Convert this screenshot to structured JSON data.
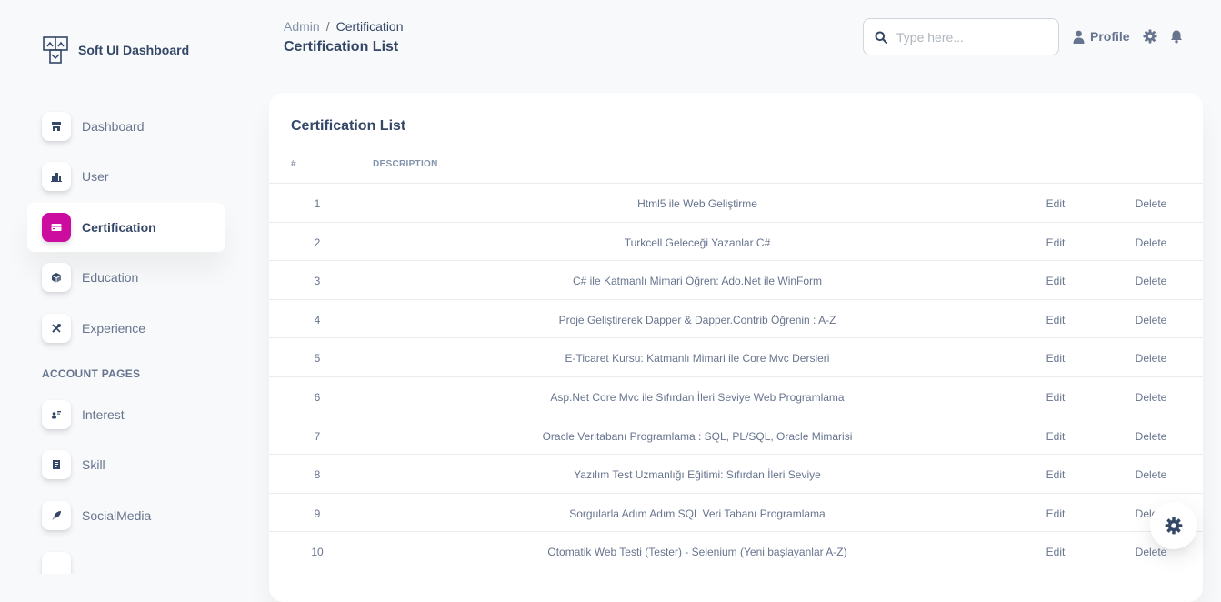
{
  "brand": {
    "name": "Soft UI Dashboard"
  },
  "sidebar": {
    "items": [
      {
        "label": "Dashboard",
        "icon": "shop-icon"
      },
      {
        "label": "User",
        "icon": "office-icon"
      },
      {
        "label": "Certification",
        "icon": "credit-card-icon",
        "active": true
      },
      {
        "label": "Education",
        "icon": "box-icon"
      },
      {
        "label": "Experience",
        "icon": "tools-icon"
      }
    ],
    "section_title": "ACCOUNT PAGES",
    "account_items": [
      {
        "label": "Interest",
        "icon": "user-card-icon"
      },
      {
        "label": "Skill",
        "icon": "document-icon"
      },
      {
        "label": "SocialMedia",
        "icon": "rocket-icon"
      }
    ],
    "accent_color": "#cb0c9f"
  },
  "header": {
    "breadcrumb": {
      "parent": "Admin",
      "separator": "/",
      "current": "Certification"
    },
    "title": "Certification List",
    "search": {
      "placeholder": "Type here...",
      "value": ""
    },
    "profile_label": "Profile"
  },
  "card": {
    "title": "Certification List",
    "columns": [
      "#",
      "DESCRIPTION"
    ],
    "edit_label": "Edit",
    "delete_label": "Delete",
    "rows": [
      {
        "num": "1",
        "description": "Html5 ile Web Geliştirme"
      },
      {
        "num": "2",
        "description": "Turkcell Geleceği Yazanlar C#"
      },
      {
        "num": "3",
        "description": "C# ile Katmanlı Mimari Öğren: Ado.Net ile WinForm"
      },
      {
        "num": "4",
        "description": "Proje Geliştirerek Dapper & Dapper.Contrib Öğrenin : A-Z"
      },
      {
        "num": "5",
        "description": "E-Ticaret Kursu: Katmanlı Mimari ile Core Mvc Dersleri"
      },
      {
        "num": "6",
        "description": "Asp.Net Core Mvc ile Sıfırdan İleri Seviye Web Programlama"
      },
      {
        "num": "7",
        "description": "Oracle Veritabanı Programlama : SQL, PL/SQL, Oracle Mimarisi"
      },
      {
        "num": "8",
        "description": "Yazılım Test Uzmanlığı Eğitimi: Sıfırdan İleri Seviye"
      },
      {
        "num": "9",
        "description": "Sorgularla Adım Adım SQL Veri Tabanı Programlama"
      },
      {
        "num": "10",
        "description": "Otomatik Web Testi (Tester) - Selenium (Yeni başlayanlar A-Z)"
      }
    ]
  }
}
